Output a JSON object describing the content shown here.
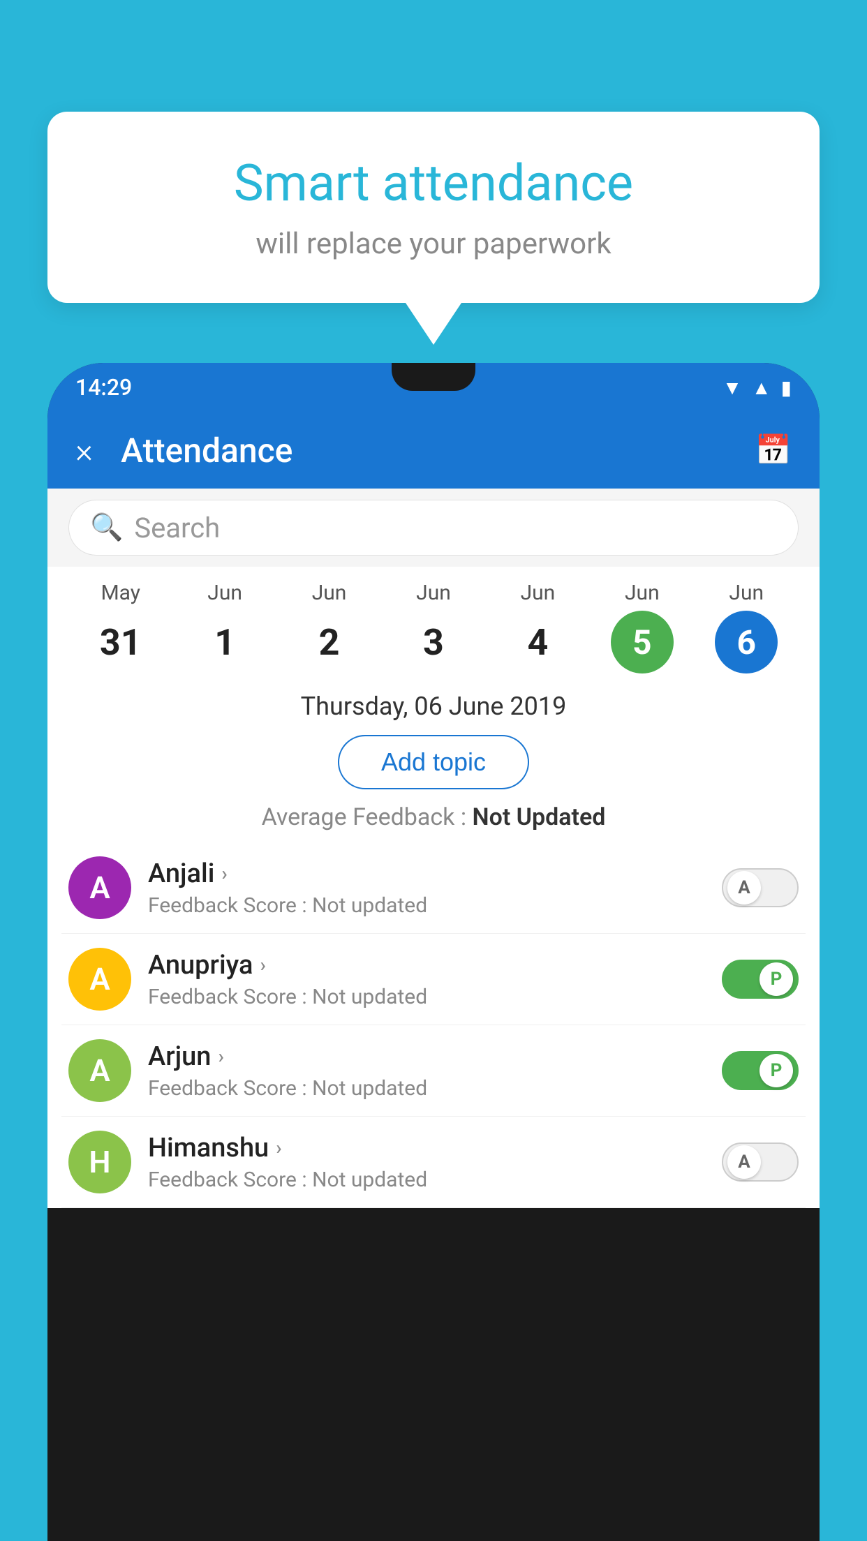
{
  "background_color": "#29B6D8",
  "speech_bubble": {
    "title": "Smart attendance",
    "subtitle": "will replace your paperwork"
  },
  "status_bar": {
    "time": "14:29",
    "icons": [
      "wifi",
      "signal",
      "battery"
    ]
  },
  "app_bar": {
    "close_label": "×",
    "title": "Attendance",
    "calendar_icon": "📅"
  },
  "search": {
    "placeholder": "Search"
  },
  "calendar": {
    "days": [
      {
        "month": "May",
        "date": "31",
        "state": "normal"
      },
      {
        "month": "Jun",
        "date": "1",
        "state": "normal"
      },
      {
        "month": "Jun",
        "date": "2",
        "state": "normal"
      },
      {
        "month": "Jun",
        "date": "3",
        "state": "normal"
      },
      {
        "month": "Jun",
        "date": "4",
        "state": "normal"
      },
      {
        "month": "Jun",
        "date": "5",
        "state": "today"
      },
      {
        "month": "Jun",
        "date": "6",
        "state": "selected"
      }
    ]
  },
  "selected_date_label": "Thursday, 06 June 2019",
  "add_topic_label": "Add topic",
  "avg_feedback_label": "Average Feedback :",
  "avg_feedback_value": "Not Updated",
  "students": [
    {
      "name": "Anjali",
      "feedback": "Feedback Score : Not updated",
      "avatar_letter": "A",
      "avatar_color": "#9C27B0",
      "toggle_state": "off",
      "toggle_letter": "A"
    },
    {
      "name": "Anupriya",
      "feedback": "Feedback Score : Not updated",
      "avatar_letter": "A",
      "avatar_color": "#FFC107",
      "toggle_state": "on",
      "toggle_letter": "P"
    },
    {
      "name": "Arjun",
      "feedback": "Feedback Score : Not updated",
      "avatar_letter": "A",
      "avatar_color": "#8BC34A",
      "toggle_state": "on",
      "toggle_letter": "P"
    },
    {
      "name": "Himanshu",
      "feedback": "Feedback Score : Not updated",
      "avatar_letter": "H",
      "avatar_color": "#8BC34A",
      "toggle_state": "off",
      "toggle_letter": "A"
    }
  ]
}
